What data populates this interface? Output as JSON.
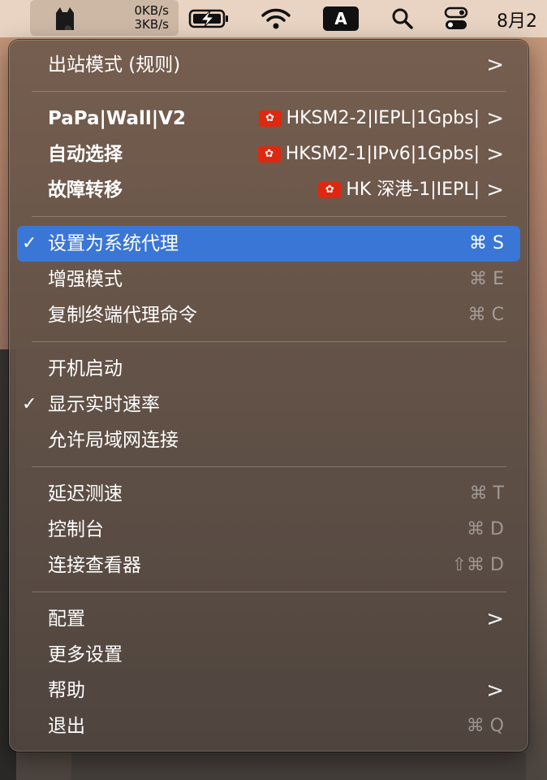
{
  "menubar": {
    "speed_up": "0KB/s",
    "speed_down": "3KB/s",
    "input_source": "A",
    "clock": "8月2"
  },
  "menu": {
    "outbound_mode": {
      "label": "出站模式 (规则)"
    },
    "groups": [
      {
        "label": "PaPa|Wall|V2",
        "selected": "HKSM2-2|IEPL|1Gpbs|"
      },
      {
        "label": "自动选择",
        "selected": "HKSM2-1|IPv6|1Gpbs|"
      },
      {
        "label": "故障转移",
        "selected": "HK 深港-1|IEPL|"
      }
    ],
    "items": {
      "system_proxy": {
        "label": "设置为系统代理",
        "shortcut": "⌘ S",
        "checked": true
      },
      "enhanced_mode": {
        "label": "增强模式",
        "shortcut": "⌘ E"
      },
      "copy_terminal": {
        "label": "复制终端代理命令",
        "shortcut": "⌘ C"
      },
      "launch_at_login": {
        "label": "开机启动"
      },
      "show_speed": {
        "label": "显示实时速率",
        "checked": true
      },
      "allow_lan": {
        "label": "允许局域网连接"
      },
      "latency_test": {
        "label": "延迟测速",
        "shortcut": "⌘ T"
      },
      "dashboard": {
        "label": "控制台",
        "shortcut": "⌘ D"
      },
      "connections": {
        "label": "连接查看器",
        "shortcut": "⇧⌘ D"
      },
      "config": {
        "label": "配置"
      },
      "more_settings": {
        "label": "更多设置"
      },
      "help": {
        "label": "帮助"
      },
      "quit": {
        "label": "退出",
        "shortcut": "⌘ Q"
      }
    },
    "check_mark": "✓",
    "submenu_chevron": ">",
    "flag_icon": "hong-kong-flag"
  },
  "colors": {
    "selection": "#3a76d6",
    "flag": "#de2910"
  }
}
